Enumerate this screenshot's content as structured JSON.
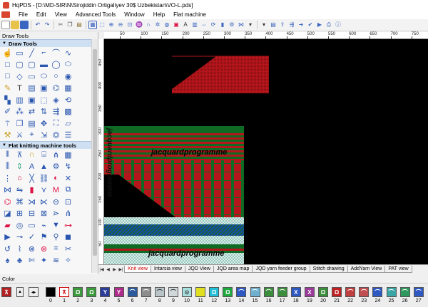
{
  "window": {
    "title": "HqPDS - [D:\\MD-SIR\\N\\Sirojiddin Ortigaliyev 30$ Uzbekistan\\VO-L.pds]"
  },
  "menu": [
    "File",
    "Edit",
    "View",
    "Advanced Tools",
    "Window",
    "Help",
    "Flat machine"
  ],
  "left_panel": {
    "title": "Draw Tools",
    "sections": [
      {
        "label": "Draw Tools"
      },
      {
        "label": "Flat knitting machine tools"
      }
    ]
  },
  "ruler": {
    "top": [
      "50",
      "100",
      "150",
      "200",
      "250",
      "300",
      "350",
      "400",
      "450",
      "500",
      "550",
      "600",
      "650",
      "700",
      "750"
    ],
    "left": [
      "450",
      "400",
      "350",
      "300",
      "250",
      "200",
      "150",
      "100",
      "50"
    ]
  },
  "canvas": {
    "watermark": "jacquardprogramme",
    "colors": {
      "background": "#000000",
      "red": "#b5161b",
      "green": "#0f6b24",
      "blue": "#1f3fb0",
      "light": "#d8efe9"
    }
  },
  "view_tabs": [
    "Knit view",
    "Intarsia view",
    "JQD View",
    "JQD area map",
    "JQD yarn feeder group",
    "Stitch drawing",
    "AddYarn View",
    "PAT view"
  ],
  "active_view_tab": "Knit view",
  "colorbar": {
    "title": "Color",
    "swatches": [
      {
        "num": "0",
        "color": "#000000",
        "glyph": ""
      },
      {
        "num": "1",
        "color": "#ffffff",
        "glyph": "⊼"
      },
      {
        "num": "2",
        "color": "#3b9a3b",
        "glyph": "Ω"
      },
      {
        "num": "3",
        "color": "#3b9a3b",
        "glyph": "Ω"
      },
      {
        "num": "4",
        "color": "#2d3d9a",
        "glyph": "Y"
      },
      {
        "num": "5",
        "color": "#b02c8c",
        "glyph": "Y"
      },
      {
        "num": "6",
        "color": "#2d5a9a",
        "glyph": "⌒"
      },
      {
        "num": "7",
        "color": "#8d8d8d",
        "glyph": "⌒"
      },
      {
        "num": "8",
        "color": "#b8c4c8",
        "glyph": "⌒"
      },
      {
        "num": "9",
        "color": "#d0d8da",
        "glyph": "⌒"
      },
      {
        "num": "10",
        "color": "#aadfdf",
        "glyph": "⊙"
      },
      {
        "num": "11",
        "color": "#e0e020",
        "glyph": ""
      },
      {
        "num": "12",
        "color": "#23bfd6",
        "glyph": "Ω"
      },
      {
        "num": "13",
        "color": "#1fa83f",
        "glyph": "Ω"
      },
      {
        "num": "14",
        "color": "#2e58c2",
        "glyph": "⌒"
      },
      {
        "num": "15",
        "color": "#6fb0d0",
        "glyph": "⌒"
      },
      {
        "num": "16",
        "color": "#3c8d3c",
        "glyph": "⌒"
      },
      {
        "num": "17",
        "color": "#3c8d3c",
        "glyph": "⌒"
      },
      {
        "num": "18",
        "color": "#2e58c2",
        "glyph": "X"
      },
      {
        "num": "19",
        "color": "#9a3a9a",
        "glyph": "X"
      },
      {
        "num": "20",
        "color": "#3c8d3c",
        "glyph": "Ω"
      },
      {
        "num": "21",
        "color": "#c02020",
        "glyph": "Ω"
      },
      {
        "num": "22",
        "color": "#c04040",
        "glyph": "⌒"
      },
      {
        "num": "23",
        "color": "#c05050",
        "glyph": "⌒"
      },
      {
        "num": "24",
        "color": "#2e58c2",
        "glyph": "⌒"
      },
      {
        "num": "25",
        "color": "#3ca5a5",
        "glyph": "⌒"
      },
      {
        "num": "26",
        "color": "#2e9a5e",
        "glyph": "⌒"
      },
      {
        "num": "27",
        "color": "#2e58c2",
        "glyph": "⌒"
      }
    ]
  }
}
